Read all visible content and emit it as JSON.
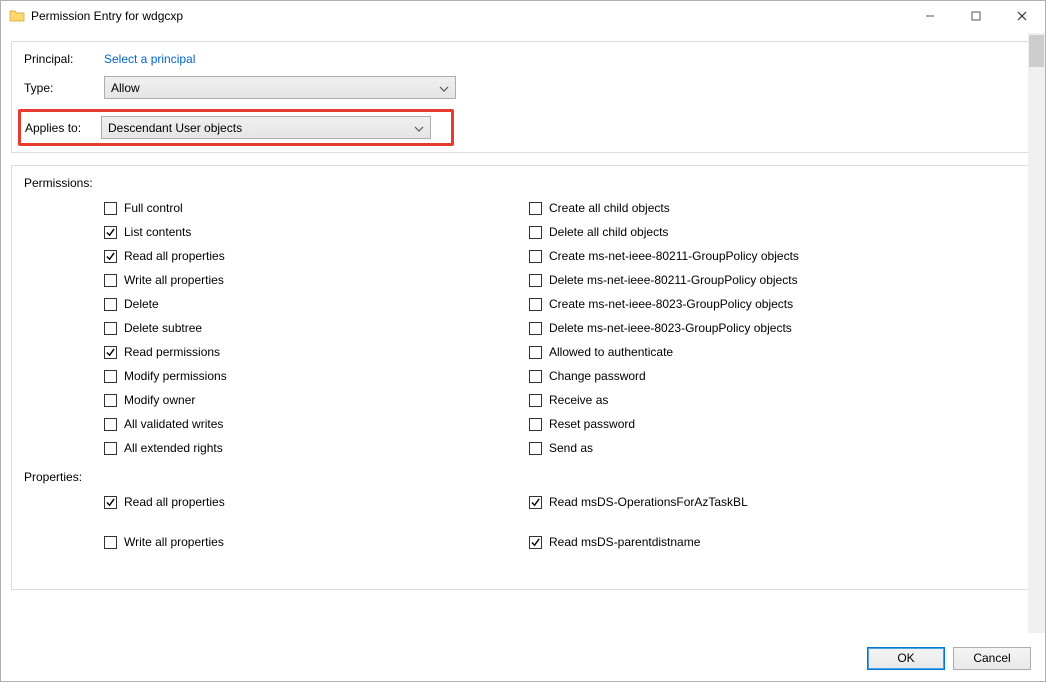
{
  "window": {
    "title": "Permission Entry for wdgcxp"
  },
  "header": {
    "principal_label": "Principal:",
    "principal_link": "Select a principal",
    "type_label": "Type:",
    "type_value": "Allow",
    "applies_label": "Applies to:",
    "applies_value": "Descendant User objects"
  },
  "permissions_label": "Permissions:",
  "perm_left": [
    {
      "label": "Full control",
      "checked": false
    },
    {
      "label": "List contents",
      "checked": true
    },
    {
      "label": "Read all properties",
      "checked": true
    },
    {
      "label": "Write all properties",
      "checked": false
    },
    {
      "label": "Delete",
      "checked": false
    },
    {
      "label": "Delete subtree",
      "checked": false
    },
    {
      "label": "Read permissions",
      "checked": true
    },
    {
      "label": "Modify permissions",
      "checked": false
    },
    {
      "label": "Modify owner",
      "checked": false
    },
    {
      "label": "All validated writes",
      "checked": false
    },
    {
      "label": "All extended rights",
      "checked": false
    }
  ],
  "perm_right": [
    {
      "label": "Create all child objects",
      "checked": false
    },
    {
      "label": "Delete all child objects",
      "checked": false
    },
    {
      "label": "Create ms-net-ieee-80211-GroupPolicy objects",
      "checked": false
    },
    {
      "label": "Delete ms-net-ieee-80211-GroupPolicy objects",
      "checked": false
    },
    {
      "label": "Create ms-net-ieee-8023-GroupPolicy objects",
      "checked": false
    },
    {
      "label": "Delete ms-net-ieee-8023-GroupPolicy objects",
      "checked": false
    },
    {
      "label": "Allowed to authenticate",
      "checked": false
    },
    {
      "label": "Change password",
      "checked": false
    },
    {
      "label": "Receive as",
      "checked": false
    },
    {
      "label": "Reset password",
      "checked": false
    },
    {
      "label": "Send as",
      "checked": false
    }
  ],
  "properties_label": "Properties:",
  "prop_left": [
    {
      "label": "Read all properties",
      "checked": true
    },
    {
      "label": "Write all properties",
      "checked": false
    }
  ],
  "prop_right": [
    {
      "label": "Read msDS-OperationsForAzTaskBL",
      "checked": true
    },
    {
      "label": "Read msDS-parentdistname",
      "checked": true
    }
  ],
  "footer": {
    "ok": "OK",
    "cancel": "Cancel"
  }
}
